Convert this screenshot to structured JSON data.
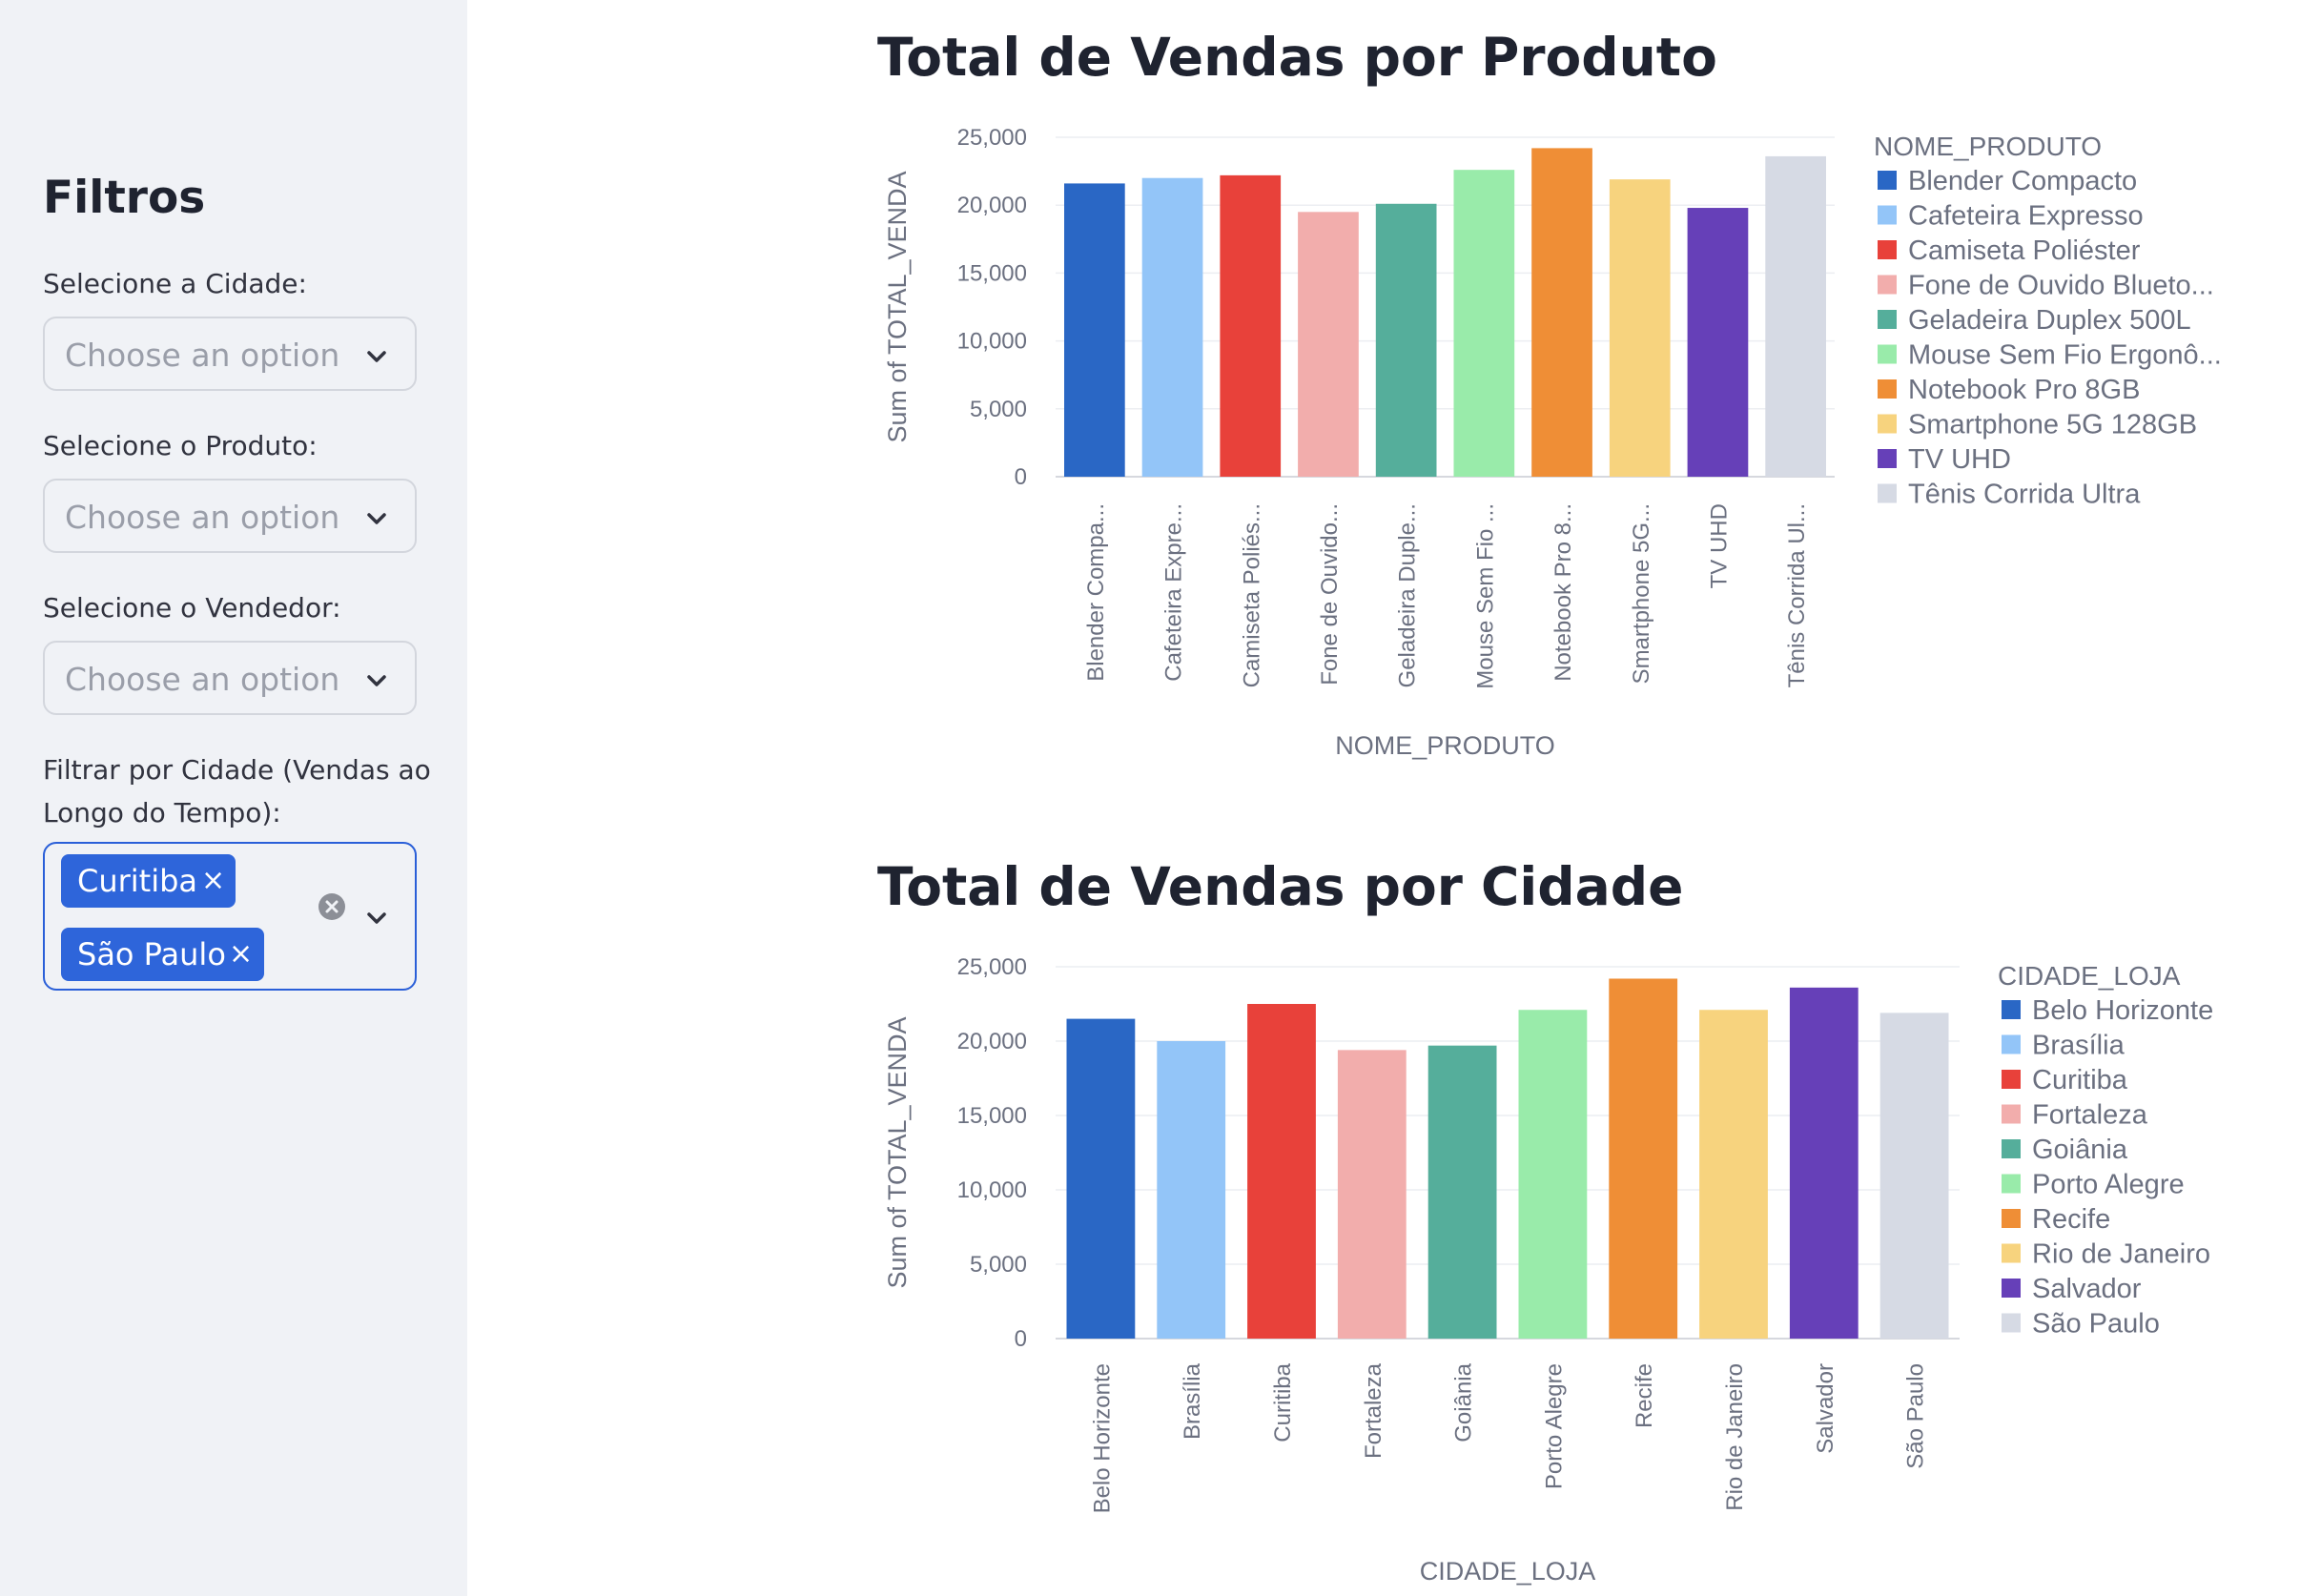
{
  "sidebar": {
    "title": "Filtros",
    "filters": [
      {
        "label": "Selecione a Cidade:",
        "placeholder": "Choose an option"
      },
      {
        "label": "Selecione o Produto:",
        "placeholder": "Choose an option"
      },
      {
        "label": "Selecione o Vendedor:",
        "placeholder": "Choose an option"
      }
    ],
    "multiselect": {
      "label_line1": "Filtrar por Cidade (Vendas ao",
      "label_line2": "Longo do Tempo):",
      "selected": [
        "Curitiba",
        "São Paulo"
      ],
      "remove_glyph": "×"
    }
  },
  "colors": [
    "#2a67c5",
    "#93c5f8",
    "#e8413a",
    "#f2adac",
    "#55ae9b",
    "#99ebaa",
    "#ef8e36",
    "#f7d37e",
    "#6640b8",
    "#d6dae4"
  ],
  "chart_data": [
    {
      "type": "bar",
      "title": "Total de Vendas por Produto",
      "xlabel": "NOME_PRODUTO",
      "ylabel": "Sum of TOTAL_VENDA",
      "legend_title": "NOME_PRODUTO",
      "legend_position": "right",
      "ylim": [
        0,
        25000
      ],
      "yticks": [
        "0",
        "5,000",
        "10,000",
        "15,000",
        "20,000",
        "25,000"
      ],
      "categories": [
        "Blender Compacto",
        "Cafeteira Expresso",
        "Camiseta Poliéster",
        "Fone de Ouvido Bluetooth",
        "Geladeira Duplex 500L",
        "Mouse Sem Fio Ergonômico",
        "Notebook Pro 8GB",
        "Smartphone 5G 128GB",
        "TV UHD",
        "Tênis Corrida Ultra"
      ],
      "tick_labels": [
        "Blender Compa...",
        "Cafeteira Expre...",
        "Camiseta Poliés...",
        "Fone de Ouvido...",
        "Geladeira Duple...",
        "Mouse Sem Fio ...",
        "Notebook Pro 8...",
        "Smartphone 5G...",
        "TV UHD",
        "Tênis Corrida Ul..."
      ],
      "legend_labels": [
        "Blender Compacto",
        "Cafeteira Expresso",
        "Camiseta Poliéster",
        "Fone de Ouvido Blueto...",
        "Geladeira Duplex 500L",
        "Mouse Sem Fio Ergonô...",
        "Notebook Pro 8GB",
        "Smartphone 5G 128GB",
        "TV UHD",
        "Tênis Corrida Ultra"
      ],
      "values": [
        21600,
        22000,
        22200,
        19500,
        20100,
        22600,
        24200,
        21900,
        19800,
        23600
      ],
      "grid": true
    },
    {
      "type": "bar",
      "title": "Total de Vendas por Cidade",
      "xlabel": "CIDADE_LOJA",
      "ylabel": "Sum of TOTAL_VENDA",
      "legend_title": "CIDADE_LOJA",
      "legend_position": "right",
      "ylim": [
        0,
        25000
      ],
      "yticks": [
        "0",
        "5,000",
        "10,000",
        "15,000",
        "20,000",
        "25,000"
      ],
      "categories": [
        "Belo Horizonte",
        "Brasília",
        "Curitiba",
        "Fortaleza",
        "Goiânia",
        "Porto Alegre",
        "Recife",
        "Rio de Janeiro",
        "Salvador",
        "São Paulo"
      ],
      "tick_labels": [
        "Belo Horizonte",
        "Brasília",
        "Curitiba",
        "Fortaleza",
        "Goiânia",
        "Porto Alegre",
        "Recife",
        "Rio de Janeiro",
        "Salvador",
        "São Paulo"
      ],
      "legend_labels": [
        "Belo Horizonte",
        "Brasília",
        "Curitiba",
        "Fortaleza",
        "Goiânia",
        "Porto Alegre",
        "Recife",
        "Rio de Janeiro",
        "Salvador",
        "São Paulo"
      ],
      "values": [
        21500,
        20000,
        22500,
        19400,
        19700,
        22100,
        24200,
        22100,
        23600,
        21900
      ],
      "grid": true
    }
  ]
}
